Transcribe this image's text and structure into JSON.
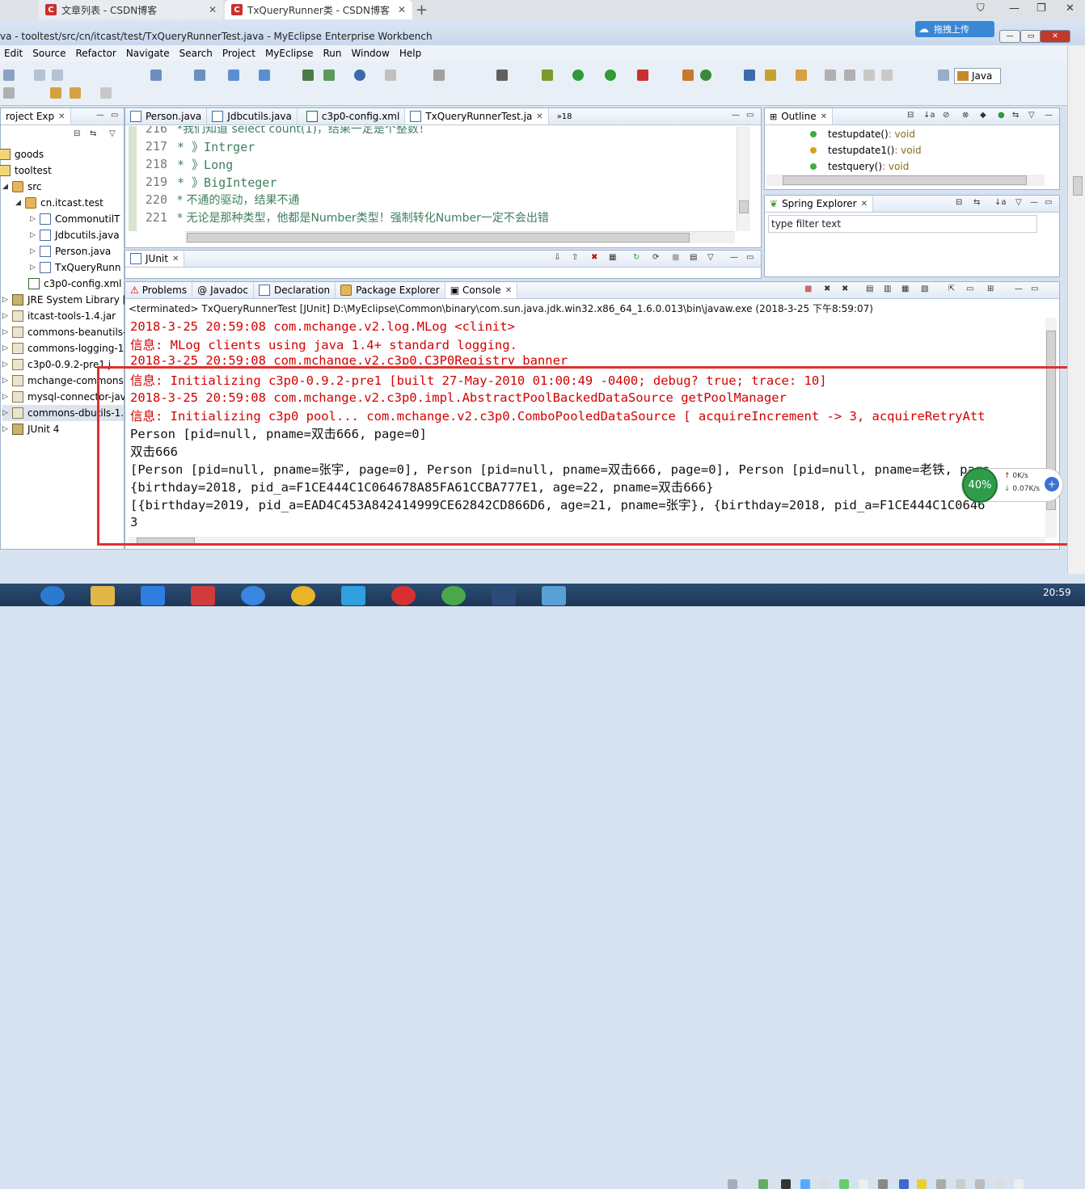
{
  "browser": {
    "tabs": [
      {
        "label": "文章列表 - CSDN博客",
        "icon": "C"
      },
      {
        "label": "TxQueryRunner类 - CSDN博客",
        "icon": "C"
      }
    ],
    "new_tab": "+",
    "window_buttons": [
      "minimize-icon",
      "restore-icon",
      "close-icon"
    ]
  },
  "window": {
    "title": "va - tooltest/src/cn/itcast/test/TxQueryRunnerTest.java - MyEclipse Enterprise Workbench",
    "upload_label": "拖拽上传"
  },
  "menu": [
    "Edit",
    "Source",
    "Refactor",
    "Navigate",
    "Search",
    "Project",
    "MyEclipse",
    "Run",
    "Window",
    "Help"
  ],
  "perspective": {
    "label": "Java"
  },
  "package_explorer": {
    "tab": "roject Exp",
    "items": [
      {
        "label": "goods",
        "indent": 0,
        "icon": "project"
      },
      {
        "label": "tooltest",
        "indent": 0,
        "icon": "project"
      },
      {
        "label": "src",
        "indent": 1,
        "icon": "src-folder"
      },
      {
        "label": "cn.itcast.test",
        "indent": 2,
        "icon": "package"
      },
      {
        "label": "CommonutilT",
        "indent": 3,
        "icon": "java-file"
      },
      {
        "label": "Jdbcutils.java",
        "indent": 3,
        "icon": "java-file"
      },
      {
        "label": "Person.java",
        "indent": 3,
        "icon": "java-file"
      },
      {
        "label": "TxQueryRunn",
        "indent": 3,
        "icon": "java-file"
      },
      {
        "label": "c3p0-config.xml",
        "indent": 2,
        "icon": "xml-file"
      },
      {
        "label": "JRE System Library [",
        "indent": 0,
        "icon": "library"
      },
      {
        "label": "itcast-tools-1.4.jar",
        "indent": 0,
        "icon": "jar"
      },
      {
        "label": "commons-beanutils-",
        "indent": 0,
        "icon": "jar"
      },
      {
        "label": "commons-logging-1",
        "indent": 0,
        "icon": "jar"
      },
      {
        "label": "c3p0-0.9.2-pre1.j",
        "indent": 0,
        "icon": "jar"
      },
      {
        "label": "mchange-commons",
        "indent": 0,
        "icon": "jar"
      },
      {
        "label": "mysql-connector-jav",
        "indent": 0,
        "icon": "jar"
      },
      {
        "label": "commons-dbutils-1.",
        "indent": 0,
        "icon": "jar"
      },
      {
        "label": "JUnit 4",
        "indent": 0,
        "icon": "library"
      }
    ]
  },
  "editor": {
    "tabs": [
      "Person.java",
      "Jdbcutils.java",
      "c3p0-config.xml",
      "TxQueryRunnerTest.ja"
    ],
    "overflow": "»18",
    "lines": [
      {
        "num": "216",
        "text": "*我们知道 select  count(1)，结果一定是个整数！"
      },
      {
        "num": "217",
        "text": "* 》Intrger"
      },
      {
        "num": "218",
        "text": "* 》Long"
      },
      {
        "num": "219",
        "text": "* 》BigInteger"
      },
      {
        "num": "220",
        "text": "* 不通的驱动，结果不通"
      },
      {
        "num": "221",
        "text": "* 无论是那种类型，他都是Number类型！强制转化Number一定不会出错"
      }
    ]
  },
  "junit": {
    "tab": "JUnit"
  },
  "outline": {
    "tab": "Outline",
    "items": [
      {
        "name": "testupdate()",
        "ret": " : void"
      },
      {
        "name": "testupdate1()",
        "ret": " : void"
      },
      {
        "name": "testquery()",
        "ret": " : void"
      }
    ]
  },
  "spring": {
    "tab": "Spring Explorer",
    "filter_placeholder": "type filter text"
  },
  "bottom_tabs": [
    "Problems",
    "Javadoc",
    "Declaration",
    "Package Explorer",
    "Console"
  ],
  "console": {
    "status": "<terminated> TxQueryRunnerTest [JUnit] D:\\MyEclipse\\Common\\binary\\com.sun.java.jdk.win32.x86_64_1.6.0.013\\bin\\javaw.exe (2018-3-25 下午8:59:07)",
    "lines": [
      {
        "text": "2018-3-25 20:59:08 com.mchange.v2.log.MLog <clinit>",
        "kind": "err"
      },
      {
        "text": "信息: MLog clients using java 1.4+ standard logging.",
        "kind": "err"
      },
      {
        "text": "2018-3-25 20:59:08 com.mchange.v2.c3p0.C3P0Registry banner",
        "kind": "err"
      },
      {
        "text": "信息: Initializing c3p0-0.9.2-pre1 [built 27-May-2010 01:00:49 -0400; debug? true; trace: 10]",
        "kind": "err"
      },
      {
        "text": "2018-3-25 20:59:08 com.mchange.v2.c3p0.impl.AbstractPoolBackedDataSource getPoolManager",
        "kind": "err"
      },
      {
        "text": "信息: Initializing c3p0 pool... com.mchange.v2.c3p0.ComboPooledDataSource [ acquireIncrement -> 3, acquireRetryAtt",
        "kind": "err"
      },
      {
        "text": "Person [pid=null, pname=双击666, page=0]",
        "kind": "out"
      },
      {
        "text": "双击666",
        "kind": "out"
      },
      {
        "text": "[Person [pid=null, pname=张宇, page=0], Person [pid=null, pname=双击666, page=0], Person [pid=null, pname=老铁, page",
        "kind": "out"
      },
      {
        "text": "{birthday=2018, pid_a=F1CE444C1C064678A85FA61CCBA777E1, age=22, pname=双击666}",
        "kind": "out"
      },
      {
        "text": "[{birthday=2019, pid_a=EAD4C453A842414999CE62842CD866D6, age=21, pname=张宇}, {birthday=2018, pid_a=F1CE444C1C0646",
        "kind": "out"
      },
      {
        "text": "3",
        "kind": "out"
      }
    ]
  },
  "speed_widget": {
    "percent": "40%",
    "up": "0K/s",
    "down": "0.07K/s"
  },
  "taskbar": {
    "clock": "20:59"
  },
  "colors": {
    "annotation": "#e03030",
    "console_error": "#d40000",
    "comment": "#3f7f5f"
  }
}
